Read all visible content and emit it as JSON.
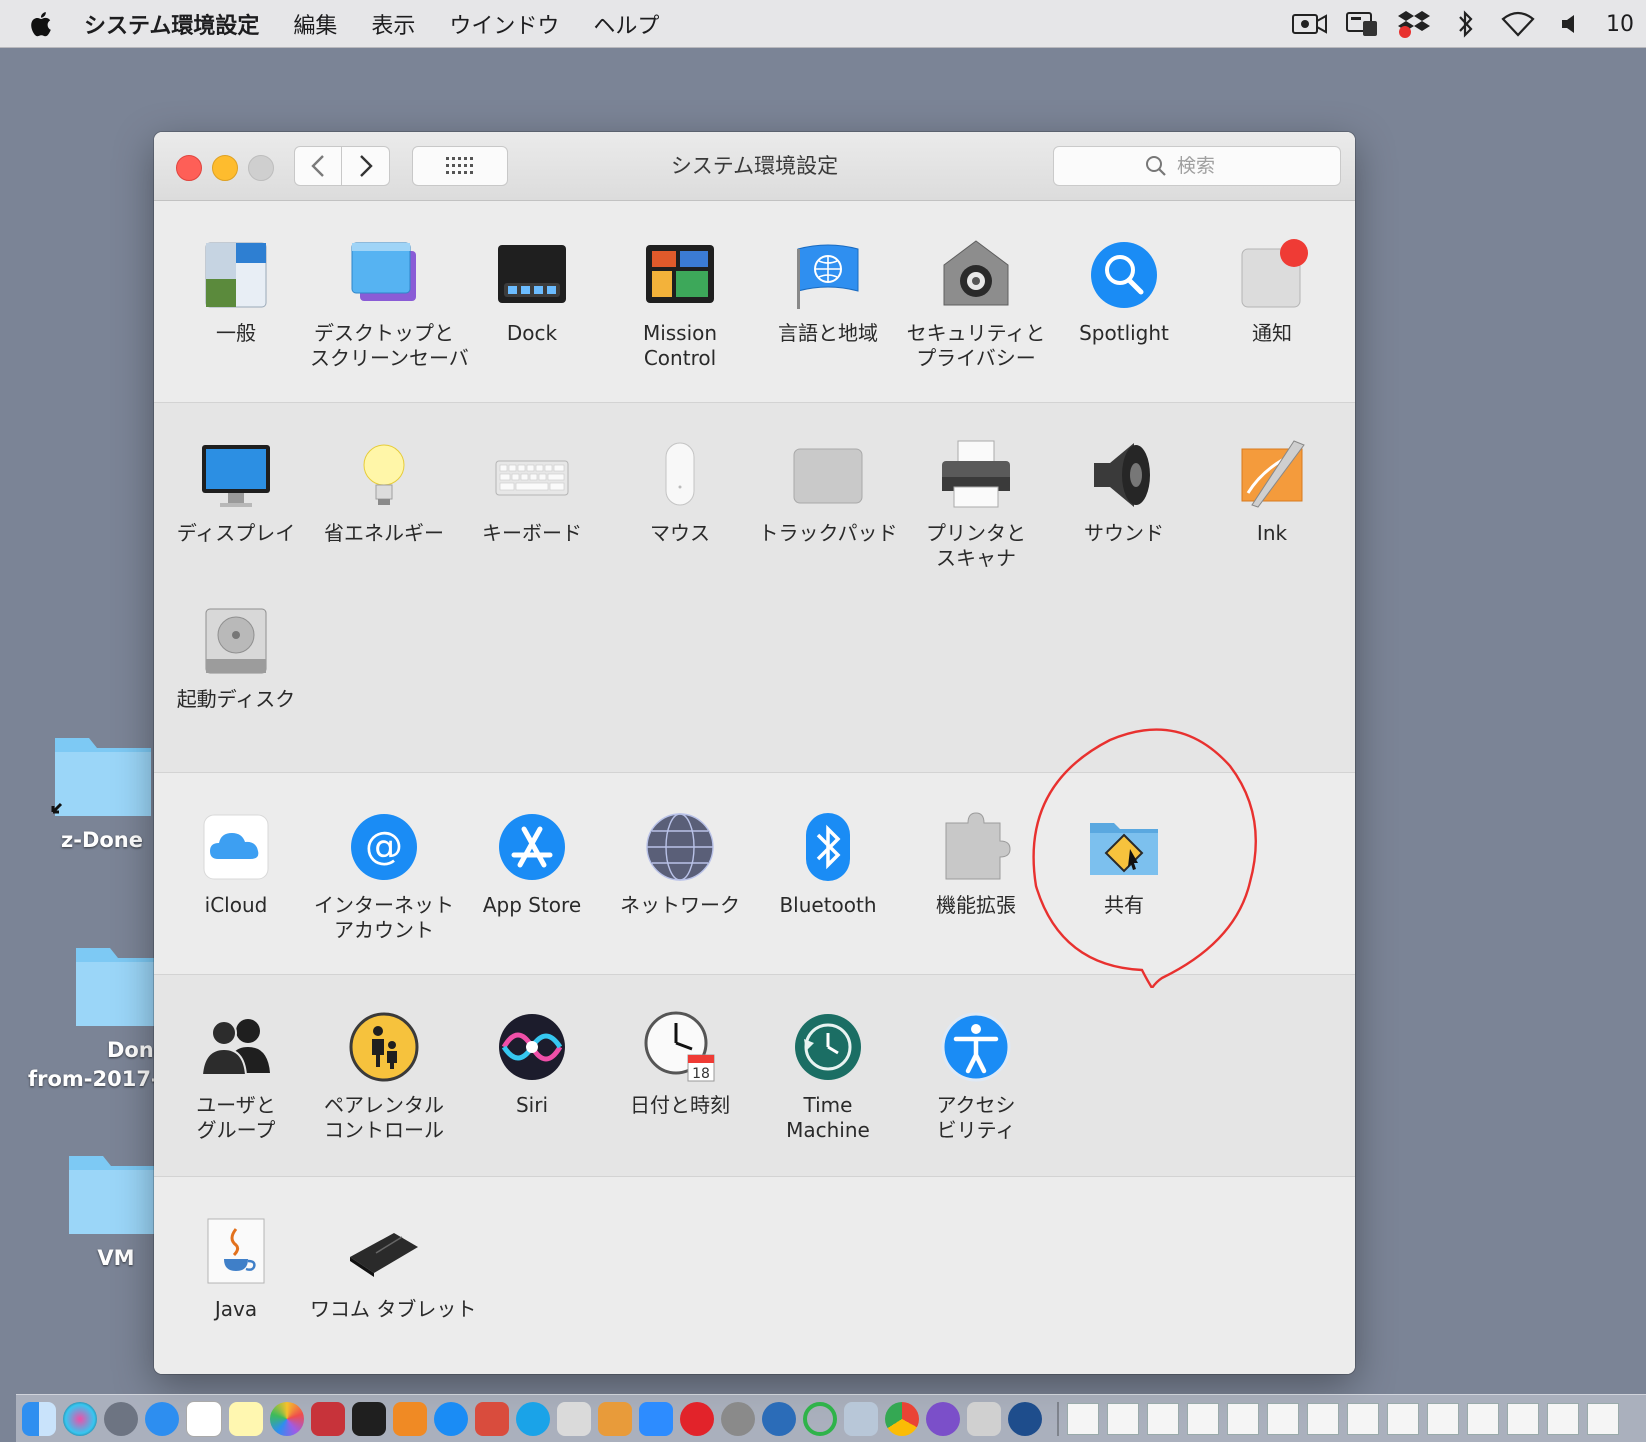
{
  "menubar": {
    "app_name": "システム環境設定",
    "items": [
      "編集",
      "表示",
      "ウインドウ",
      "ヘルプ"
    ],
    "clock": "10"
  },
  "desktop": {
    "folders": [
      {
        "lines": [
          "z-Done"
        ]
      },
      {
        "lines": [
          "Done",
          "from-2017-"
        ]
      },
      {
        "lines": [
          "VM"
        ]
      }
    ]
  },
  "window": {
    "title": "システム環境設定",
    "search_placeholder": "検索",
    "sections": [
      {
        "panes": [
          {
            "id": "general",
            "label": [
              "一般"
            ],
            "icon": "general-icon"
          },
          {
            "id": "desktop",
            "label": [
              "デスクトップと",
              "スクリーンセーバ"
            ],
            "icon": "desktop-screensaver-icon"
          },
          {
            "id": "dock",
            "label": [
              "Dock"
            ],
            "icon": "dock-icon"
          },
          {
            "id": "mission",
            "label": [
              "Mission",
              "Control"
            ],
            "icon": "mission-control-icon"
          },
          {
            "id": "language",
            "label": [
              "言語と地域"
            ],
            "icon": "language-region-icon"
          },
          {
            "id": "security",
            "label": [
              "セキュリティと",
              "プライバシー"
            ],
            "icon": "security-icon"
          },
          {
            "id": "spotlight",
            "label": [
              "Spotlight"
            ],
            "icon": "spotlight-icon"
          },
          {
            "id": "notifications",
            "label": [
              "通知"
            ],
            "icon": "notifications-icon"
          }
        ]
      },
      {
        "panes": [
          {
            "id": "displays",
            "label": [
              "ディスプレイ"
            ],
            "icon": "display-icon"
          },
          {
            "id": "energy",
            "label": [
              "省エネルギー"
            ],
            "icon": "energy-saver-icon"
          },
          {
            "id": "keyboard",
            "label": [
              "キーボード"
            ],
            "icon": "keyboard-icon"
          },
          {
            "id": "mouse",
            "label": [
              "マウス"
            ],
            "icon": "mouse-icon"
          },
          {
            "id": "trackpad",
            "label": [
              "トラックパッド"
            ],
            "icon": "trackpad-icon"
          },
          {
            "id": "printers",
            "label": [
              "プリンタと",
              "スキャナ"
            ],
            "icon": "printer-icon"
          },
          {
            "id": "sound",
            "label": [
              "サウンド"
            ],
            "icon": "sound-icon"
          },
          {
            "id": "ink",
            "label": [
              "Ink"
            ],
            "icon": "ink-icon"
          },
          {
            "id": "startup",
            "label": [
              "起動ディスク"
            ],
            "icon": "startup-disk-icon"
          }
        ]
      },
      {
        "panes": [
          {
            "id": "icloud",
            "label": [
              "iCloud"
            ],
            "icon": "icloud-icon"
          },
          {
            "id": "internet",
            "label": [
              "インターネット",
              "アカウント"
            ],
            "icon": "internet-accounts-icon"
          },
          {
            "id": "appstore",
            "label": [
              "App Store"
            ],
            "icon": "app-store-icon"
          },
          {
            "id": "network",
            "label": [
              "ネットワーク"
            ],
            "icon": "network-icon"
          },
          {
            "id": "bluetooth",
            "label": [
              "Bluetooth"
            ],
            "icon": "bluetooth-icon"
          },
          {
            "id": "extensions",
            "label": [
              "機能拡張"
            ],
            "icon": "extensions-icon"
          },
          {
            "id": "sharing",
            "label": [
              "共有"
            ],
            "icon": "sharing-icon"
          }
        ]
      },
      {
        "panes": [
          {
            "id": "users",
            "label": [
              "ユーザと",
              "グループ"
            ],
            "icon": "users-groups-icon"
          },
          {
            "id": "parental",
            "label": [
              "ペアレンタル",
              "コントロール"
            ],
            "icon": "parental-controls-icon"
          },
          {
            "id": "siri",
            "label": [
              "Siri"
            ],
            "icon": "siri-icon"
          },
          {
            "id": "datetime",
            "label": [
              "日付と時刻"
            ],
            "icon": "date-time-icon"
          },
          {
            "id": "timemachine",
            "label": [
              "Time",
              "Machine"
            ],
            "icon": "time-machine-icon"
          },
          {
            "id": "accessibility",
            "label": [
              "アクセシ",
              "ビリティ"
            ],
            "icon": "accessibility-icon"
          }
        ]
      },
      {
        "panes": [
          {
            "id": "java",
            "label": [
              "Java"
            ],
            "icon": "java-icon"
          },
          {
            "id": "wacom",
            "label": [
              "ワコム タブレット"
            ],
            "icon": "wacom-tablet-icon"
          }
        ]
      }
    ],
    "calendar_day": "18"
  },
  "annotation": {
    "color": "#e8312f",
    "target": "sharing"
  },
  "colors": {
    "accent": "#1a8cf5",
    "close": "#fe5f57",
    "minimize": "#febc2e"
  }
}
